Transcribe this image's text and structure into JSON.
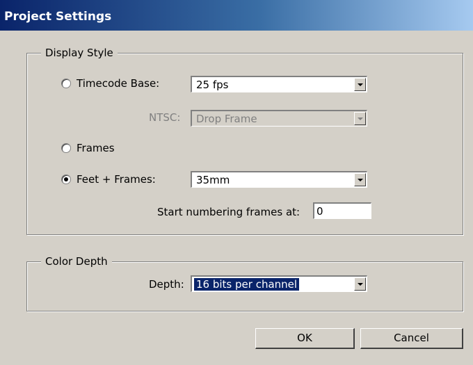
{
  "window": {
    "title": "Project Settings"
  },
  "display_style": {
    "legend": "Display Style",
    "timecode_base": {
      "label": "Timecode Base:",
      "value": "25 fps",
      "selected": false
    },
    "ntsc": {
      "label": "NTSC:",
      "value": "Drop Frame",
      "enabled": false
    },
    "frames": {
      "label": "Frames",
      "selected": false
    },
    "feet_frames": {
      "label": "Feet + Frames:",
      "value": "35mm",
      "selected": true
    },
    "start_numbering": {
      "label": "Start numbering frames at:",
      "value": "0"
    }
  },
  "color_depth": {
    "legend": "Color Depth",
    "depth": {
      "label": "Depth:",
      "value": "16 bits per channel"
    }
  },
  "buttons": {
    "ok": "OK",
    "cancel": "Cancel"
  }
}
